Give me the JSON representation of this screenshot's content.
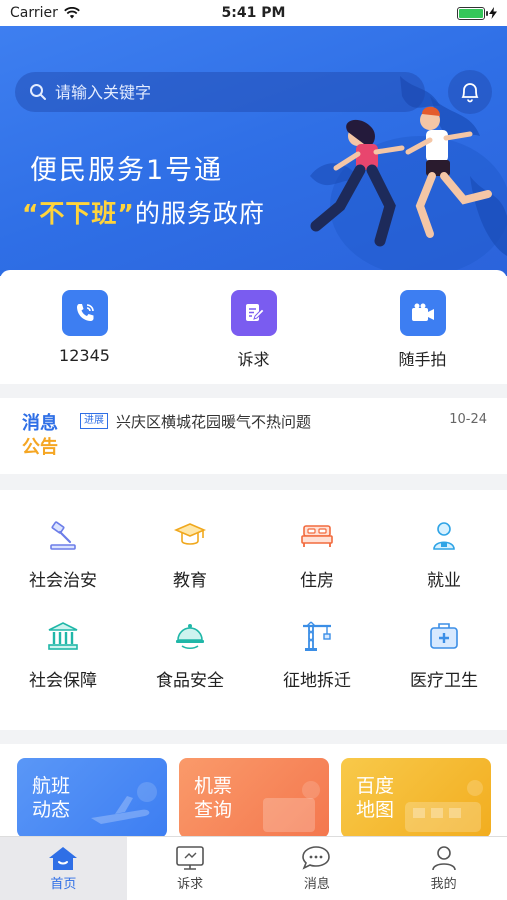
{
  "status_bar": {
    "carrier": "Carrier",
    "time": "5:41 PM",
    "battery_level": 1.0
  },
  "search": {
    "placeholder": "请输入关键字"
  },
  "banner": {
    "title": "便民服务1号通",
    "subtitle_highlight": "“不下班”",
    "subtitle_rest": "的服务政府"
  },
  "quick_actions": [
    {
      "label": "12345",
      "icon": "phone-icon",
      "color": "#3d7ef2"
    },
    {
      "label": "诉求",
      "icon": "edit-icon",
      "color": "#7a5cf0"
    },
    {
      "label": "随手拍",
      "icon": "video-icon",
      "color": "#3d7ef2"
    }
  ],
  "notice": {
    "tag_line1": "消息",
    "tag_line2": "公告",
    "badge": "进展",
    "text": "兴庆区横城花园暖气不热问题",
    "date": "10-24"
  },
  "categories": [
    {
      "label": "社会治安",
      "icon": "gavel-icon"
    },
    {
      "label": "教育",
      "icon": "graduation-cap-icon"
    },
    {
      "label": "住房",
      "icon": "bed-icon"
    },
    {
      "label": "就业",
      "icon": "worker-icon"
    },
    {
      "label": "社会保障",
      "icon": "bank-icon"
    },
    {
      "label": "食品安全",
      "icon": "food-cover-icon"
    },
    {
      "label": "征地拆迁",
      "icon": "crane-icon"
    },
    {
      "label": "医疗卫生",
      "icon": "medical-kit-icon"
    }
  ],
  "service_cards": [
    {
      "label": "航班动态",
      "color": "#4a8af4"
    },
    {
      "label": "机票查询",
      "color": "#f6835a"
    },
    {
      "label": "百度地图",
      "color": "#f5b82e"
    }
  ],
  "tabs": [
    {
      "label": "首页",
      "icon": "home-icon",
      "active": true
    },
    {
      "label": "诉求",
      "icon": "monitor-icon",
      "active": false
    },
    {
      "label": "消息",
      "icon": "chat-icon",
      "active": false
    },
    {
      "label": "我的",
      "icon": "user-icon",
      "active": false
    }
  ],
  "colors": {
    "primary": "#2f6fe6",
    "accent_yellow": "#ffd43b",
    "notice_orange": "#f5a623"
  }
}
